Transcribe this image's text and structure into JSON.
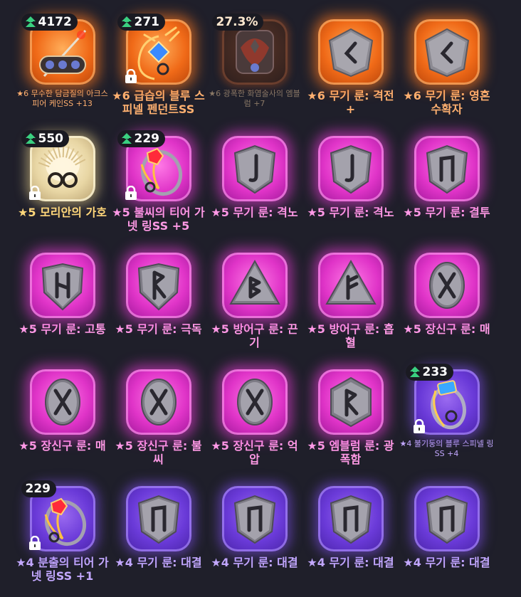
{
  "colors": {
    "background": "#1f1f2a",
    "orange_frame": "#f06a18",
    "pink_frame": "#e034c8",
    "purple_frame": "#6a3ad8",
    "star": "#ffc83a"
  },
  "items": [
    {
      "tier": "orange",
      "art": "cane",
      "badge": "4172",
      "badge_type": "power",
      "locked": false,
      "label": "★6 무수한 담금질의 아크스피어 케인SS +13",
      "label_style": "small orangey"
    },
    {
      "tier": "orange",
      "art": "pendant-blue",
      "badge": "271",
      "badge_type": "power",
      "locked": true,
      "label": "★6 급습의 블루 스피넬 펜던트SS",
      "label_style": "orangey"
    },
    {
      "tier": "orange-dim",
      "art": "emblem",
      "badge": "27.3%",
      "badge_type": "pct",
      "locked": false,
      "label": "★6 광폭한 화염술사의 엠블럼 +7",
      "label_style": "dim"
    },
    {
      "tier": "orange",
      "art": "rune-lt",
      "badge": "",
      "badge_type": "",
      "locked": false,
      "label": "★6 무기 룬: 격전+",
      "label_style": "orangey"
    },
    {
      "tier": "orange",
      "art": "rune-lt",
      "badge": "",
      "badge_type": "",
      "locked": false,
      "label": "★6 무기 룬: 영혼 수확자",
      "label_style": "orangey"
    },
    {
      "tier": "gold",
      "art": "sun-glasses",
      "badge": "550",
      "badge_type": "power",
      "locked": true,
      "label": "★5 모리안의 가호",
      "label_style": ""
    },
    {
      "tier": "pink",
      "art": "ring-red",
      "badge": "229",
      "badge_type": "power",
      "locked": true,
      "label": "★5 불씨의 티어 가넷 링SS +5",
      "label_style": "pinky"
    },
    {
      "tier": "pink",
      "art": "rune-j",
      "badge": "",
      "badge_type": "",
      "locked": false,
      "label": "★5 무기 룬: 격노",
      "label_style": "pinky"
    },
    {
      "tier": "pink",
      "art": "rune-j",
      "badge": "",
      "badge_type": "",
      "locked": false,
      "label": "★5 무기 룬: 격노",
      "label_style": "pinky"
    },
    {
      "tier": "pink",
      "art": "rune-n",
      "badge": "",
      "badge_type": "",
      "locked": false,
      "label": "★5 무기 룬: 결투",
      "label_style": "pinky"
    },
    {
      "tier": "pink",
      "art": "shield-h",
      "badge": "",
      "badge_type": "",
      "locked": false,
      "label": "★5 무기 룬: 고통",
      "label_style": "pinky"
    },
    {
      "tier": "pink",
      "art": "shield-r",
      "badge": "",
      "badge_type": "",
      "locked": false,
      "label": "★5 무기 룬: 극독",
      "label_style": "pinky"
    },
    {
      "tier": "pink",
      "art": "tri-b",
      "badge": "",
      "badge_type": "",
      "locked": false,
      "label": "★5 방어구 룬: 끈기",
      "label_style": "pinky"
    },
    {
      "tier": "pink",
      "art": "tri-f",
      "badge": "",
      "badge_type": "",
      "locked": false,
      "label": "★5 방어구 룬: 흡혈",
      "label_style": "pinky"
    },
    {
      "tier": "pink",
      "art": "oval-x",
      "badge": "",
      "badge_type": "",
      "locked": false,
      "label": "★5 장신구 룬: 매",
      "label_style": "pinky"
    },
    {
      "tier": "pink",
      "art": "oval-x",
      "badge": "",
      "badge_type": "",
      "locked": false,
      "label": "★5 장신구 룬: 매",
      "label_style": "pinky"
    },
    {
      "tier": "pink",
      "art": "oval-x",
      "badge": "",
      "badge_type": "",
      "locked": false,
      "label": "★5 장신구 룬: 불씨",
      "label_style": "pinky"
    },
    {
      "tier": "pink",
      "art": "oval-x",
      "badge": "",
      "badge_type": "",
      "locked": false,
      "label": "★5 장신구 룬: 억압",
      "label_style": "pinky"
    },
    {
      "tier": "pink",
      "art": "hex-r",
      "badge": "",
      "badge_type": "",
      "locked": false,
      "label": "★5 엠블럼 룬: 광폭함",
      "label_style": "pinky"
    },
    {
      "tier": "purple",
      "art": "ring-blue",
      "badge": "233",
      "badge_type": "power",
      "locked": true,
      "label": "★4 불기둥의 블루 스피넬 링SS +4",
      "label_style": "small purply"
    },
    {
      "tier": "purple",
      "art": "ring-red",
      "badge": "229",
      "badge_type": "plain",
      "locked": true,
      "label": "★4 분출의 티어 가넷 링SS +1",
      "label_style": "purply"
    },
    {
      "tier": "purple",
      "art": "rune-n",
      "badge": "",
      "badge_type": "",
      "locked": false,
      "label": "★4 무기 룬: 대결",
      "label_style": "purply"
    },
    {
      "tier": "purple",
      "art": "rune-n",
      "badge": "",
      "badge_type": "",
      "locked": false,
      "label": "★4 무기 룬: 대결",
      "label_style": "purply"
    },
    {
      "tier": "purple",
      "art": "rune-n",
      "badge": "",
      "badge_type": "",
      "locked": false,
      "label": "★4 무기 룬: 대결",
      "label_style": "purply"
    },
    {
      "tier": "purple",
      "art": "rune-n",
      "badge": "",
      "badge_type": "",
      "locked": false,
      "label": "★4 무기 룬: 대결",
      "label_style": "purply"
    }
  ]
}
